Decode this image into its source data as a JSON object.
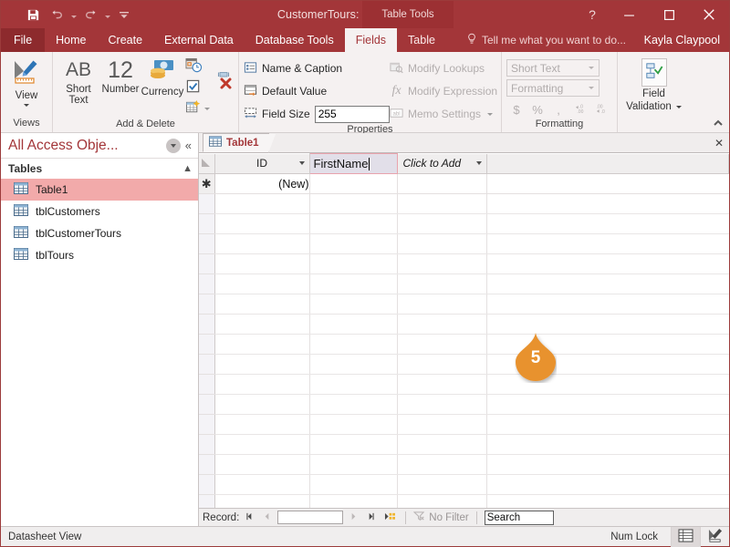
{
  "titlebar": {
    "window_title": "CustomerTours: Database- \\Cus...",
    "context_tools": "Table Tools",
    "qat": [
      {
        "name": "save-icon",
        "label": "Save"
      },
      {
        "name": "undo-icon",
        "label": "Undo"
      },
      {
        "name": "redo-icon",
        "label": "Redo"
      },
      {
        "name": "customize-qat-icon",
        "label": "Customize Quick Access Toolbar"
      }
    ],
    "help_label": "?",
    "minimize_label": "—",
    "maximize_label": "□",
    "close_label": "✕"
  },
  "tabs": {
    "file": "File",
    "items": [
      {
        "label": "Home",
        "active": false
      },
      {
        "label": "Create",
        "active": false
      },
      {
        "label": "External Data",
        "active": false
      },
      {
        "label": "Database Tools",
        "active": false
      },
      {
        "label": "Fields",
        "active": true
      },
      {
        "label": "Table",
        "active": false
      }
    ],
    "tell_me": "Tell me what you want to do...",
    "user": "Kayla Claypool"
  },
  "ribbon": {
    "views": {
      "group_label": "Views",
      "view_button": "View"
    },
    "add_delete": {
      "group_label": "Add & Delete",
      "short_text": "Short Text",
      "number": "Number",
      "number_glyph": "12",
      "short_text_glyph": "AB",
      "currency": "Currency",
      "date_time_icon": "date-time-icon",
      "yes_no_icon": "yes-no-icon",
      "more_fields_icon": "more-fields-icon",
      "delete_icon": "delete-field-icon"
    },
    "properties": {
      "group_label": "Properties",
      "name_caption": "Name & Caption",
      "default_value": "Default Value",
      "field_size_label": "Field Size",
      "field_size_value": "255",
      "modify_lookups": "Modify Lookups",
      "modify_expression": "Modify Expression",
      "memo_settings": "Memo Settings"
    },
    "formatting": {
      "group_label": "Formatting",
      "data_type": "Short Text",
      "format": "Formatting",
      "currency_btn": "$",
      "percent_btn": "%",
      "comma_btn": ",",
      "decrease_decimal": "←.0",
      "increase_decimal": ".00"
    },
    "field_validation": {
      "group_label": "",
      "label_line1": "Field",
      "label_line2": "Validation"
    },
    "collapse_ribbon": "⌃"
  },
  "navpane": {
    "title": "All Access Obje...",
    "group": "Tables",
    "items": [
      {
        "label": "Table1",
        "selected": true
      },
      {
        "label": "tblCustomers",
        "selected": false
      },
      {
        "label": "tblCustomerTours",
        "selected": false
      },
      {
        "label": "tblTours",
        "selected": false
      }
    ]
  },
  "document": {
    "tab_label": "Table1",
    "close_label": "✕"
  },
  "datasheet": {
    "columns": [
      {
        "label": "ID",
        "align": "num",
        "state": "normal"
      },
      {
        "label": "FirstName",
        "align": "left",
        "state": "editing"
      },
      {
        "label": "Click to Add",
        "align": "left",
        "state": "clicktoadd"
      }
    ],
    "rows": [
      {
        "selector": "✱",
        "cells": [
          "(New)",
          "",
          ""
        ]
      }
    ],
    "empty_row_count": 15
  },
  "recordnav": {
    "label": "Record:",
    "first": "◀|",
    "prev": "◀",
    "value": "",
    "next": "▶",
    "last": "|▶",
    "new": "▶✱",
    "filter_label": "No Filter",
    "search_value": "Search"
  },
  "statusbar": {
    "view_label": "Datasheet View",
    "num_lock": "Num Lock",
    "datasheet_view_icon": "datasheet-view-icon",
    "design_view_icon": "design-view-icon"
  },
  "callout": {
    "number": "5",
    "color": "#E8922F"
  }
}
